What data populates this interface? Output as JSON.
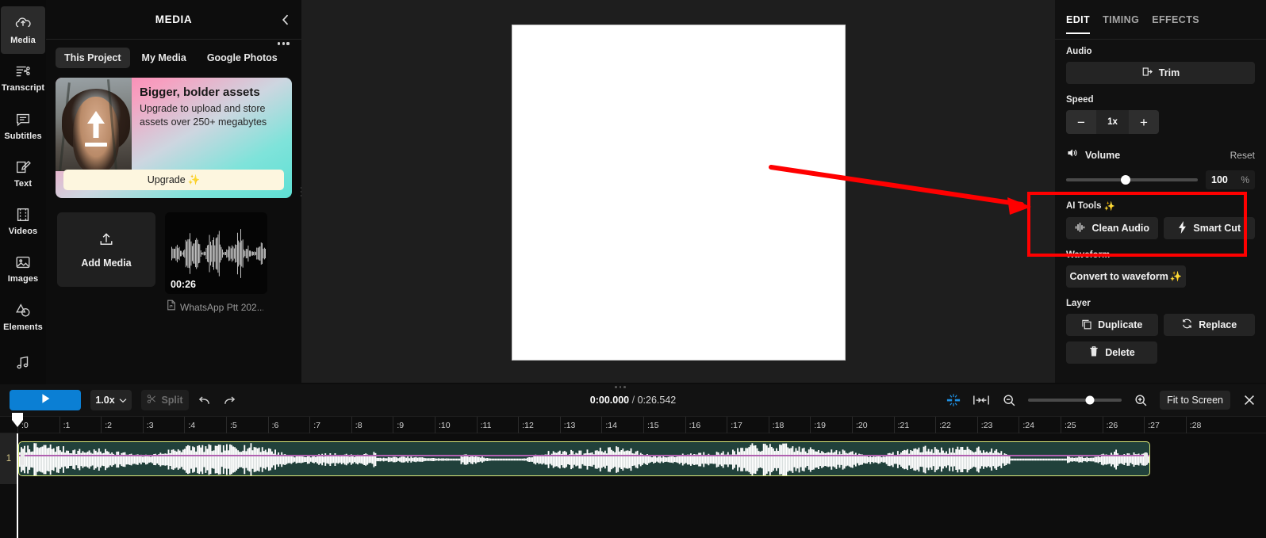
{
  "app": {
    "rail": {
      "items": [
        {
          "label": "Media",
          "icon": "upload-cloud-icon",
          "active": true
        },
        {
          "label": "Transcript",
          "icon": "transcript-scissors-icon",
          "active": false
        },
        {
          "label": "Subtitles",
          "icon": "speech-bubble-icon",
          "active": false
        },
        {
          "label": "Text",
          "icon": "text-edit-icon",
          "active": false
        },
        {
          "label": "Videos",
          "icon": "film-strip-icon",
          "active": false
        },
        {
          "label": "Images",
          "icon": "picture-icon",
          "active": false
        },
        {
          "label": "Elements",
          "icon": "shapes-icon",
          "active": false
        },
        {
          "label": "",
          "icon": "music-note-icon",
          "active": false
        }
      ]
    },
    "media_panel": {
      "title": "MEDIA",
      "collapse_icon": "chevron-left-icon",
      "kebab_icon": "more-options-icon",
      "tabs": [
        {
          "label": "This Project",
          "active": true
        },
        {
          "label": "My Media",
          "active": false
        },
        {
          "label": "Google Photos",
          "active": false
        }
      ],
      "promo": {
        "heading": "Bigger, bolder assets",
        "body": "Upgrade to upload and store assets over 250+ megabytes",
        "cta": "Upgrade",
        "cta_sparkle": "✨"
      },
      "add_media_label": "Add Media",
      "add_media_icon": "upload-icon",
      "asset": {
        "duration": "00:26",
        "name": "WhatsApp Ptt 202...",
        "file_icon": "audio-file-icon"
      }
    },
    "inspector": {
      "tabs": [
        {
          "label": "EDIT",
          "active": true
        },
        {
          "label": "TIMING",
          "active": false
        },
        {
          "label": "EFFECTS",
          "active": false
        }
      ],
      "audio": {
        "label": "Audio",
        "trim_label": "Trim",
        "trim_icon": "trim-icon"
      },
      "speed": {
        "label": "Speed",
        "minus": "−",
        "value": "1x",
        "plus": "+"
      },
      "volume": {
        "label": "Volume",
        "icon": "speaker-icon",
        "reset": "Reset",
        "value": "100",
        "unit": "%",
        "slider_pct": 45
      },
      "ai_tools": {
        "label": "AI Tools",
        "sparkle": "✨",
        "buttons": [
          {
            "label": "Clean Audio",
            "icon": "audio-wave-icon"
          },
          {
            "label": "Smart Cut",
            "icon": "lightning-bolt-icon"
          }
        ]
      },
      "waveform": {
        "label": "Waveform",
        "button": "Convert to waveform",
        "sparkle": "✨"
      },
      "layer": {
        "label": "Layer",
        "duplicate": "Duplicate",
        "duplicate_icon": "copy-icon",
        "replace": "Replace",
        "replace_icon": "refresh-icon",
        "delete": "Delete",
        "delete_icon": "trash-icon"
      }
    },
    "timeline": {
      "play_icon": "play-icon",
      "rate": "1.0x",
      "rate_caret": "chevron-down-icon",
      "split": "Split",
      "split_icon": "scissors-icon",
      "undo_icon": "undo-icon",
      "redo_icon": "redo-icon",
      "current_time": "0:00.000",
      "separator": "/",
      "total_time": "0:26.542",
      "magnet_icon": "snap-magnet-icon",
      "fit_markers_icon": "fit-markers-icon",
      "zoom_out_icon": "zoom-out-icon",
      "zoom_in_icon": "zoom-in-icon",
      "zoom_pct": 66,
      "fit_to_screen": "Fit to Screen",
      "close_icon": "close-icon",
      "ruler_ticks": [
        ":0",
        ":1",
        ":2",
        ":3",
        ":4",
        ":5",
        ":6",
        ":7",
        ":8",
        ":9",
        ":10",
        ":11",
        ":12",
        ":13",
        ":14",
        ":15",
        ":16",
        ":17",
        ":18",
        ":19",
        ":20",
        ":21",
        ":22",
        ":23",
        ":24",
        ":25",
        ":26",
        ":27",
        ":28"
      ],
      "track_number": "1",
      "clip": {
        "type": "audio-waveform",
        "border_color": "#d9e87a",
        "fill_color": "#21413b"
      }
    },
    "annotations": {
      "highlight_box_color": "#ff0000",
      "arrow_color": "#ff0000"
    },
    "colors": {
      "accent_blue": "#0b7fd4",
      "panel_bg": "#111111",
      "preview_bg": "#1e1e1e",
      "clip_border": "#d9e87a"
    }
  }
}
